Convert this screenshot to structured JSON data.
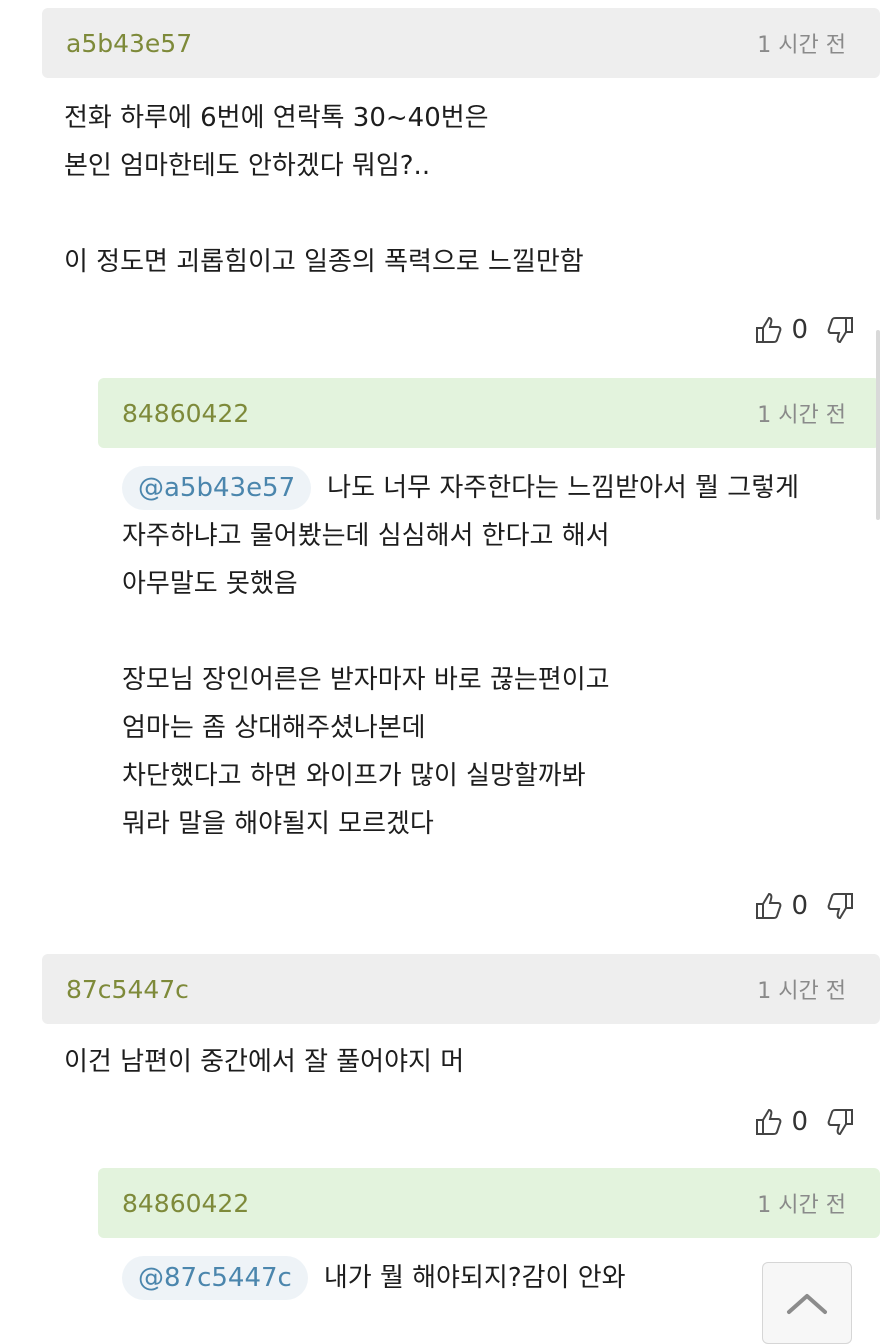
{
  "comments": [
    {
      "author": "a5b43e57",
      "time": "1 시간 전",
      "lines": [
        "전화 하루에 6번에 연락톡 30~40번은",
        "본인 엄마한테도 안하겠다 뭐임?..",
        "",
        "이 정도면 괴롭힘이고 일종의 폭력으로 느낄만함"
      ],
      "likes": "0"
    },
    {
      "author": "84860422",
      "time": "1 시간 전",
      "mention": "@a5b43e57",
      "first_line": "나도 너무 자주한다는 느낌받아서 뭘 그렇게",
      "lines": [
        "자주하냐고 물어봤는데 심심해서 한다고 해서",
        "아무말도 못했음",
        "",
        "장모님 장인어른은 받자마자 바로 끊는편이고",
        "엄마는 좀 상대해주셨나본데",
        "차단했다고 하면 와이프가 많이 실망할까봐",
        "뭐라 말을 해야될지 모르겠다"
      ],
      "likes": "0"
    },
    {
      "author": "87c5447c",
      "time": "1 시간 전",
      "lines": [
        "이건 남편이 중간에서 잘 풀어야지 머"
      ],
      "likes": "0"
    },
    {
      "author": "84860422",
      "time": "1 시간 전",
      "mention": "@87c5447c",
      "first_line": "내가 뭘 해야되지?감이 안와"
    }
  ],
  "icons": {
    "like": "thumbs-up-icon",
    "dislike": "thumbs-down-icon",
    "scroll_top": "chevron-up-icon"
  },
  "colors": {
    "author": "#7e8a3a",
    "reply_header_bg": "#e3f3dd",
    "header_bg": "#eeeeee",
    "mention": "#4b86ad"
  }
}
